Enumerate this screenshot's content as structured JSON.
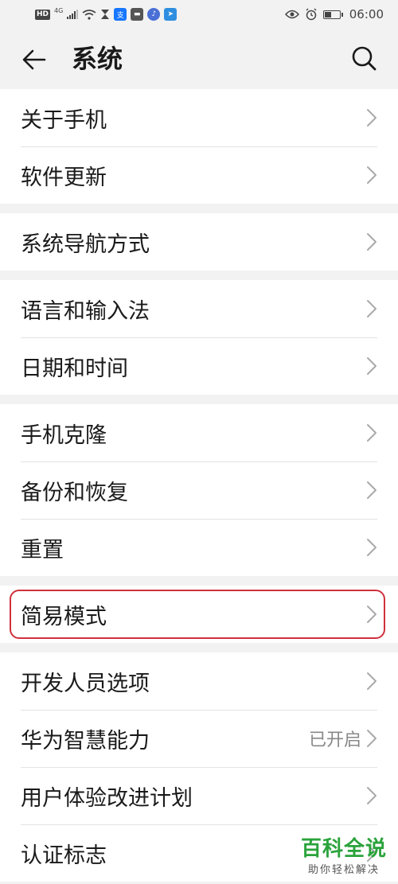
{
  "status_bar": {
    "time": "06:00",
    "left_icons": [
      "hd-icon",
      "signal-icon",
      "wifi-icon",
      "hourglass-icon",
      "alipay-icon",
      "message-icon",
      "music-icon",
      "send-icon"
    ],
    "hd_label": "HD",
    "network_label": "4G",
    "right_icons": [
      "eye-icon",
      "alarm-icon",
      "battery-icon"
    ]
  },
  "header": {
    "title": "系统",
    "back_icon": "back-arrow-icon",
    "search_icon": "search-icon"
  },
  "groups": [
    {
      "items": [
        {
          "label": "关于手机"
        },
        {
          "label": "软件更新"
        }
      ]
    },
    {
      "items": [
        {
          "label": "系统导航方式"
        }
      ]
    },
    {
      "items": [
        {
          "label": "语言和输入法"
        },
        {
          "label": "日期和时间"
        }
      ]
    },
    {
      "items": [
        {
          "label": "手机克隆"
        },
        {
          "label": "备份和恢复"
        },
        {
          "label": "重置"
        }
      ]
    },
    {
      "items": [
        {
          "label": "简易模式",
          "highlighted": true
        }
      ]
    },
    {
      "items": [
        {
          "label": "开发人员选项"
        },
        {
          "label": "华为智慧能力",
          "status": "已开启"
        },
        {
          "label": "用户体验改进计划"
        },
        {
          "label": "认证标志"
        }
      ]
    }
  ],
  "colors": {
    "highlight": "#d0303c",
    "watermark": "#2aa33b",
    "background": "#f2f2f2"
  },
  "watermark": {
    "title": "百科全说",
    "subtitle": "助你轻松解决"
  }
}
